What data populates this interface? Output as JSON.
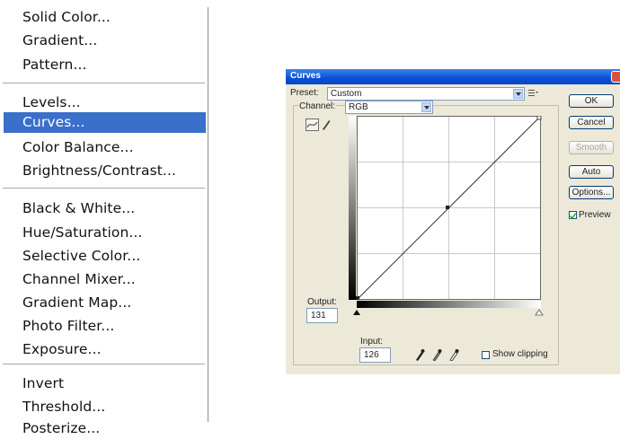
{
  "menu": {
    "group1": [
      "Solid Color...",
      "Gradient...",
      "Pattern..."
    ],
    "group2": [
      "Levels...",
      "Curves...",
      "Color Balance...",
      "Brightness/Contrast..."
    ],
    "group3": [
      "Black & White...",
      "Hue/Saturation...",
      "Selective Color...",
      "Channel Mixer...",
      "Gradient Map...",
      "Photo Filter...",
      "Exposure..."
    ],
    "group4": [
      "Invert",
      "Threshold...",
      "Posterize..."
    ],
    "selected": "Curves...",
    "highlight_color": "#3a6fca"
  },
  "dialog": {
    "title": "Curves",
    "preset_label": "Preset:",
    "preset_value": "Custom",
    "channel_label": "Channel:",
    "channel_value": "RGB",
    "output_label": "Output:",
    "output_value": "131",
    "input_label": "Input:",
    "input_value": "126",
    "show_clipping_label": "Show clipping",
    "preview_label": "Preview",
    "preview_checked": true,
    "buttons": {
      "ok": "OK",
      "cancel": "Cancel",
      "smooth": "Smooth",
      "auto": "Auto",
      "options": "Options..."
    },
    "titlebar_color": "#0a4fd6"
  }
}
